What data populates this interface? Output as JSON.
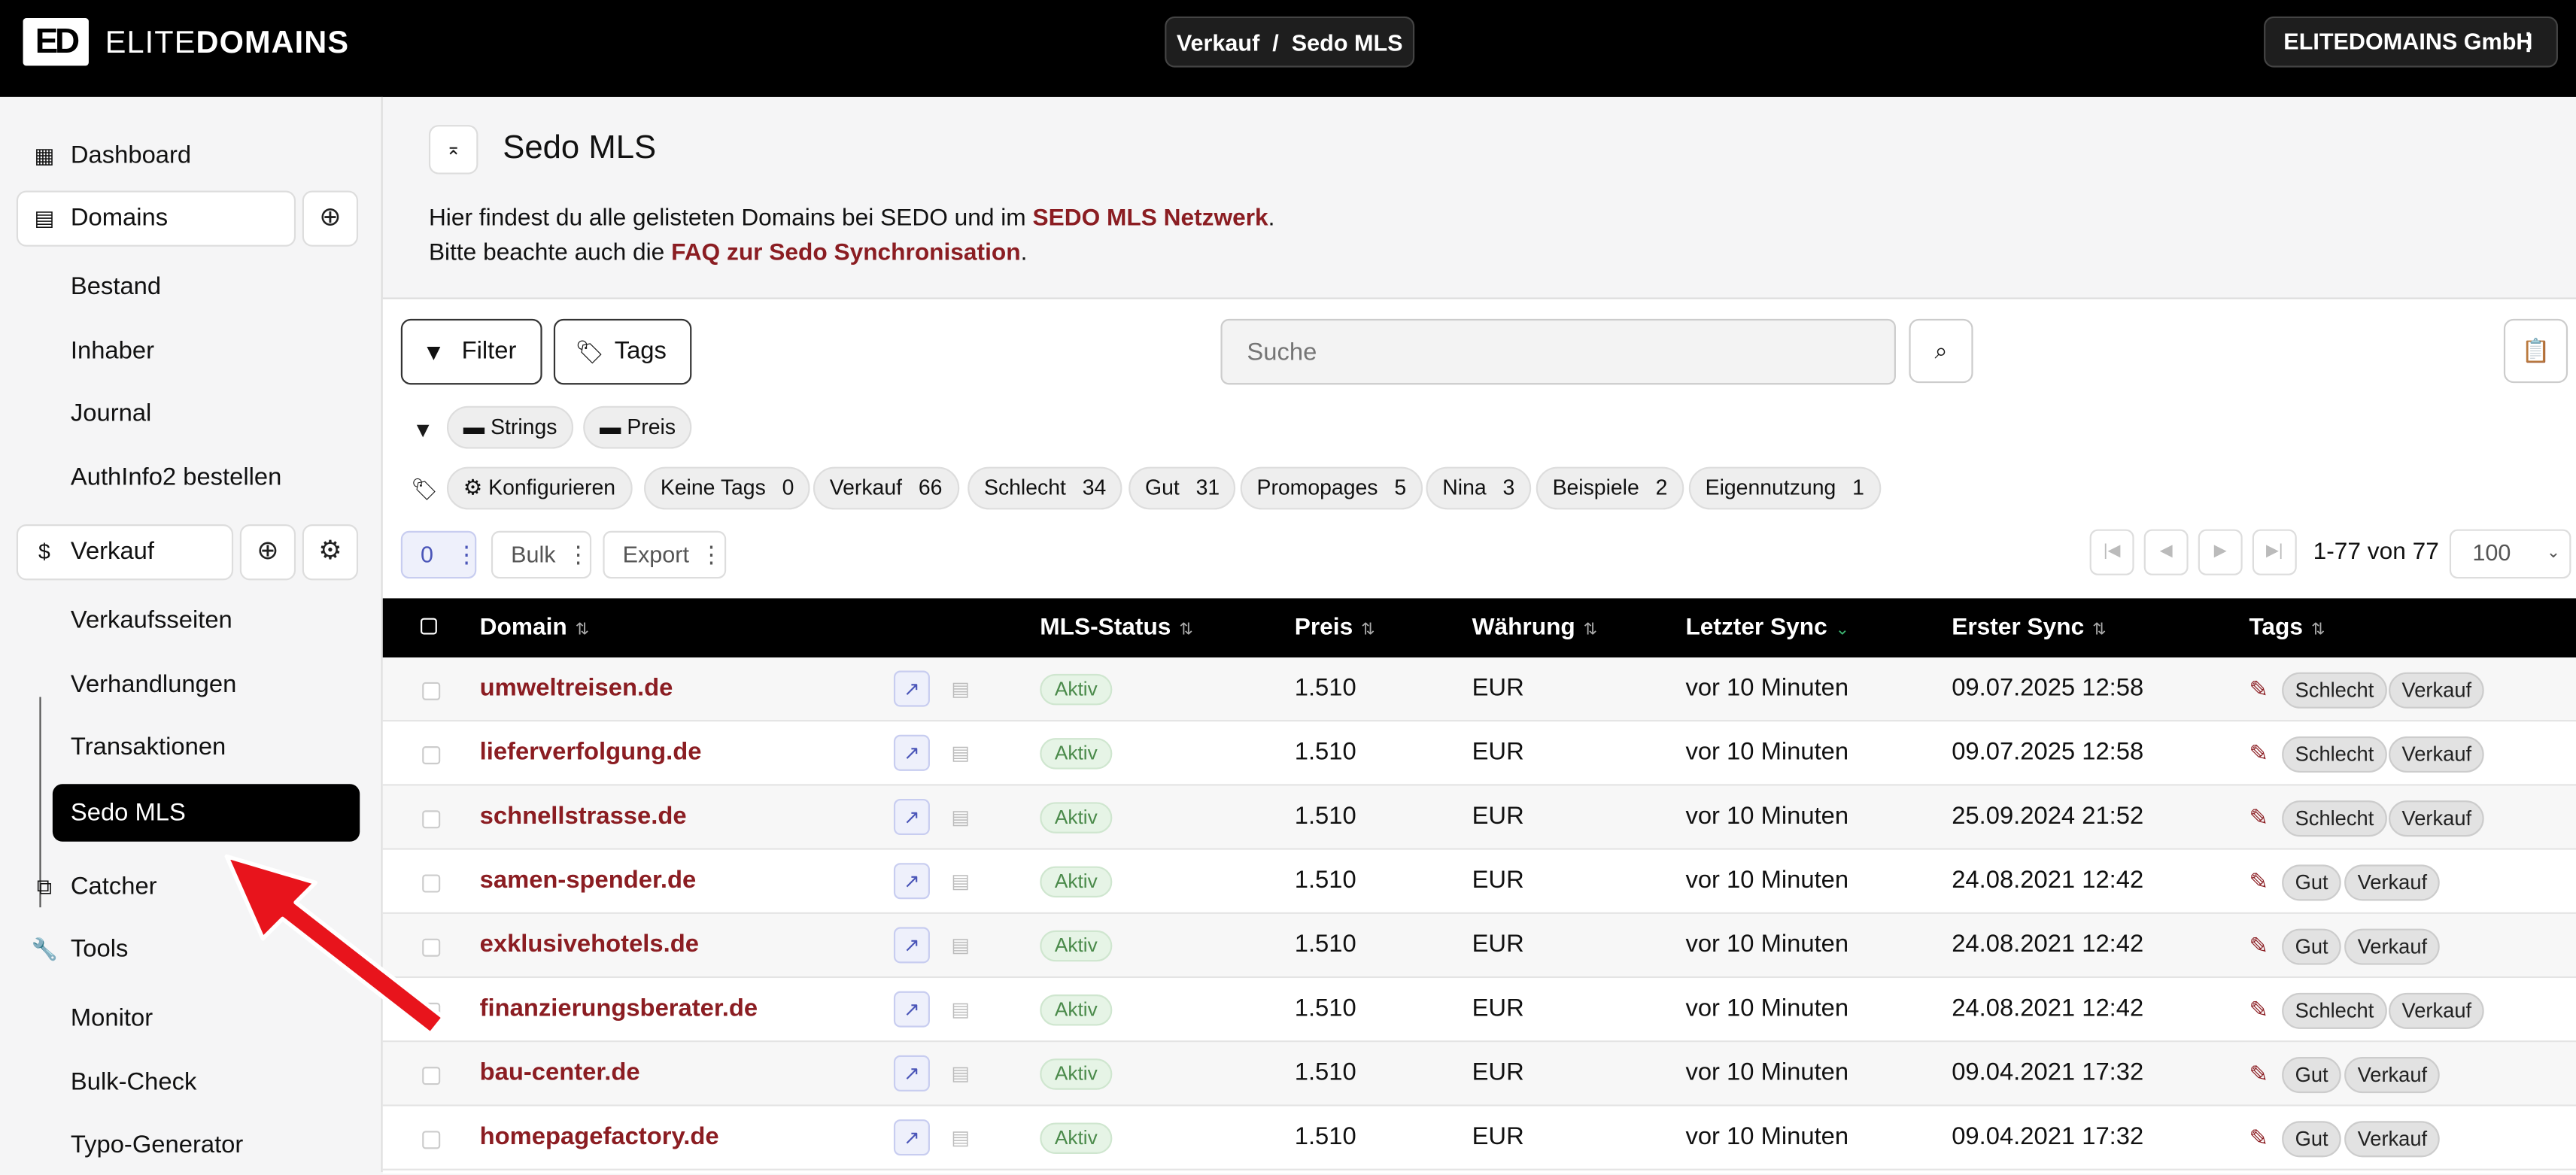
{
  "topbar": {
    "logo_mark": "ED",
    "logo_text_light": "ELITE",
    "logo_text_bold": "DOMAINS",
    "breadcrumb": "Verkauf  /  Sedo MLS",
    "company": "ELITEDOMAINS GmbH",
    "company_menu": "⋮"
  },
  "sidebar": {
    "dashboard": "Dashboard",
    "domains": "Domains",
    "domains_items": [
      "Bestand",
      "Inhaber",
      "Journal",
      "AuthInfo2 bestellen"
    ],
    "verkauf": "Verkauf",
    "verkauf_items": [
      "Verkaufsseiten",
      "Verhandlungen",
      "Transaktionen"
    ],
    "active": "Sedo MLS",
    "catcher": "Catcher",
    "tools": "Tools",
    "tools_items": [
      "Monitor",
      "Bulk-Check",
      "Typo-Generator"
    ]
  },
  "main": {
    "title": "Sedo MLS",
    "desc1_pre": "Hier findest du alle gelisteten Domains bei SEDO und im ",
    "desc1_link": "SEDO MLS Netzwerk",
    "desc1_post": ".",
    "desc2_pre": "Bitte beachte auch die ",
    "desc2_link": "FAQ zur Sedo Synchronisation",
    "desc2_post": ".",
    "filter_label": "Filter",
    "tags_label": "Tags",
    "search_placeholder": "Suche",
    "filter_chips": [
      "Strings",
      "Preis"
    ],
    "configure_label": "Konfigurieren",
    "tag_chips": [
      {
        "label": "Keine Tags",
        "count": "0"
      },
      {
        "label": "Verkauf",
        "count": "66"
      },
      {
        "label": "Schlecht",
        "count": "34"
      },
      {
        "label": "Gut",
        "count": "31"
      },
      {
        "label": "Promopages",
        "count": "5"
      },
      {
        "label": "Nina",
        "count": "3"
      },
      {
        "label": "Beispiele",
        "count": "2"
      },
      {
        "label": "Eigennutzung",
        "count": "1"
      }
    ],
    "selected_count": "0",
    "bulk_label": "Bulk",
    "export_label": "Export",
    "pagination_text": "1-77 von 77",
    "page_size": "100"
  },
  "table": {
    "headers": {
      "domain": "Domain",
      "mls_status": "MLS-Status",
      "preis": "Preis",
      "waehrung": "Währung",
      "letzter_sync": "Letzter Sync",
      "erster_sync": "Erster Sync",
      "tags": "Tags"
    },
    "rows": [
      {
        "domain": "umweltreisen.de",
        "status": "Aktiv",
        "preis": "1.510",
        "waehrung": "EUR",
        "letzter": "vor 10 Minuten",
        "erster": "09.07.2025 12:58",
        "tags": [
          "Schlecht",
          "Verkauf"
        ]
      },
      {
        "domain": "lieferverfolgung.de",
        "status": "Aktiv",
        "preis": "1.510",
        "waehrung": "EUR",
        "letzter": "vor 10 Minuten",
        "erster": "09.07.2025 12:58",
        "tags": [
          "Schlecht",
          "Verkauf"
        ]
      },
      {
        "domain": "schnellstrasse.de",
        "status": "Aktiv",
        "preis": "1.510",
        "waehrung": "EUR",
        "letzter": "vor 10 Minuten",
        "erster": "25.09.2024 21:52",
        "tags": [
          "Schlecht",
          "Verkauf"
        ]
      },
      {
        "domain": "samen-spender.de",
        "status": "Aktiv",
        "preis": "1.510",
        "waehrung": "EUR",
        "letzter": "vor 10 Minuten",
        "erster": "24.08.2021 12:42",
        "tags": [
          "Gut",
          "Verkauf"
        ]
      },
      {
        "domain": "exklusivehotels.de",
        "status": "Aktiv",
        "preis": "1.510",
        "waehrung": "EUR",
        "letzter": "vor 10 Minuten",
        "erster": "24.08.2021 12:42",
        "tags": [
          "Gut",
          "Verkauf"
        ]
      },
      {
        "domain": "finanzierungsberater.de",
        "status": "Aktiv",
        "preis": "1.510",
        "waehrung": "EUR",
        "letzter": "vor 10 Minuten",
        "erster": "24.08.2021 12:42",
        "tags": [
          "Schlecht",
          "Verkauf"
        ]
      },
      {
        "domain": "bau-center.de",
        "status": "Aktiv",
        "preis": "1.510",
        "waehrung": "EUR",
        "letzter": "vor 10 Minuten",
        "erster": "09.04.2021 17:32",
        "tags": [
          "Gut",
          "Verkauf"
        ]
      },
      {
        "domain": "homepagefactory.de",
        "status": "Aktiv",
        "preis": "1.510",
        "waehrung": "EUR",
        "letzter": "vor 10 Minuten",
        "erster": "09.04.2021 17:32",
        "tags": [
          "Gut",
          "Verkauf"
        ]
      }
    ]
  },
  "colors": {
    "brand_red": "#8b1d22",
    "active_green": "#4a8a4a",
    "arrow_red": "#e8141c"
  }
}
